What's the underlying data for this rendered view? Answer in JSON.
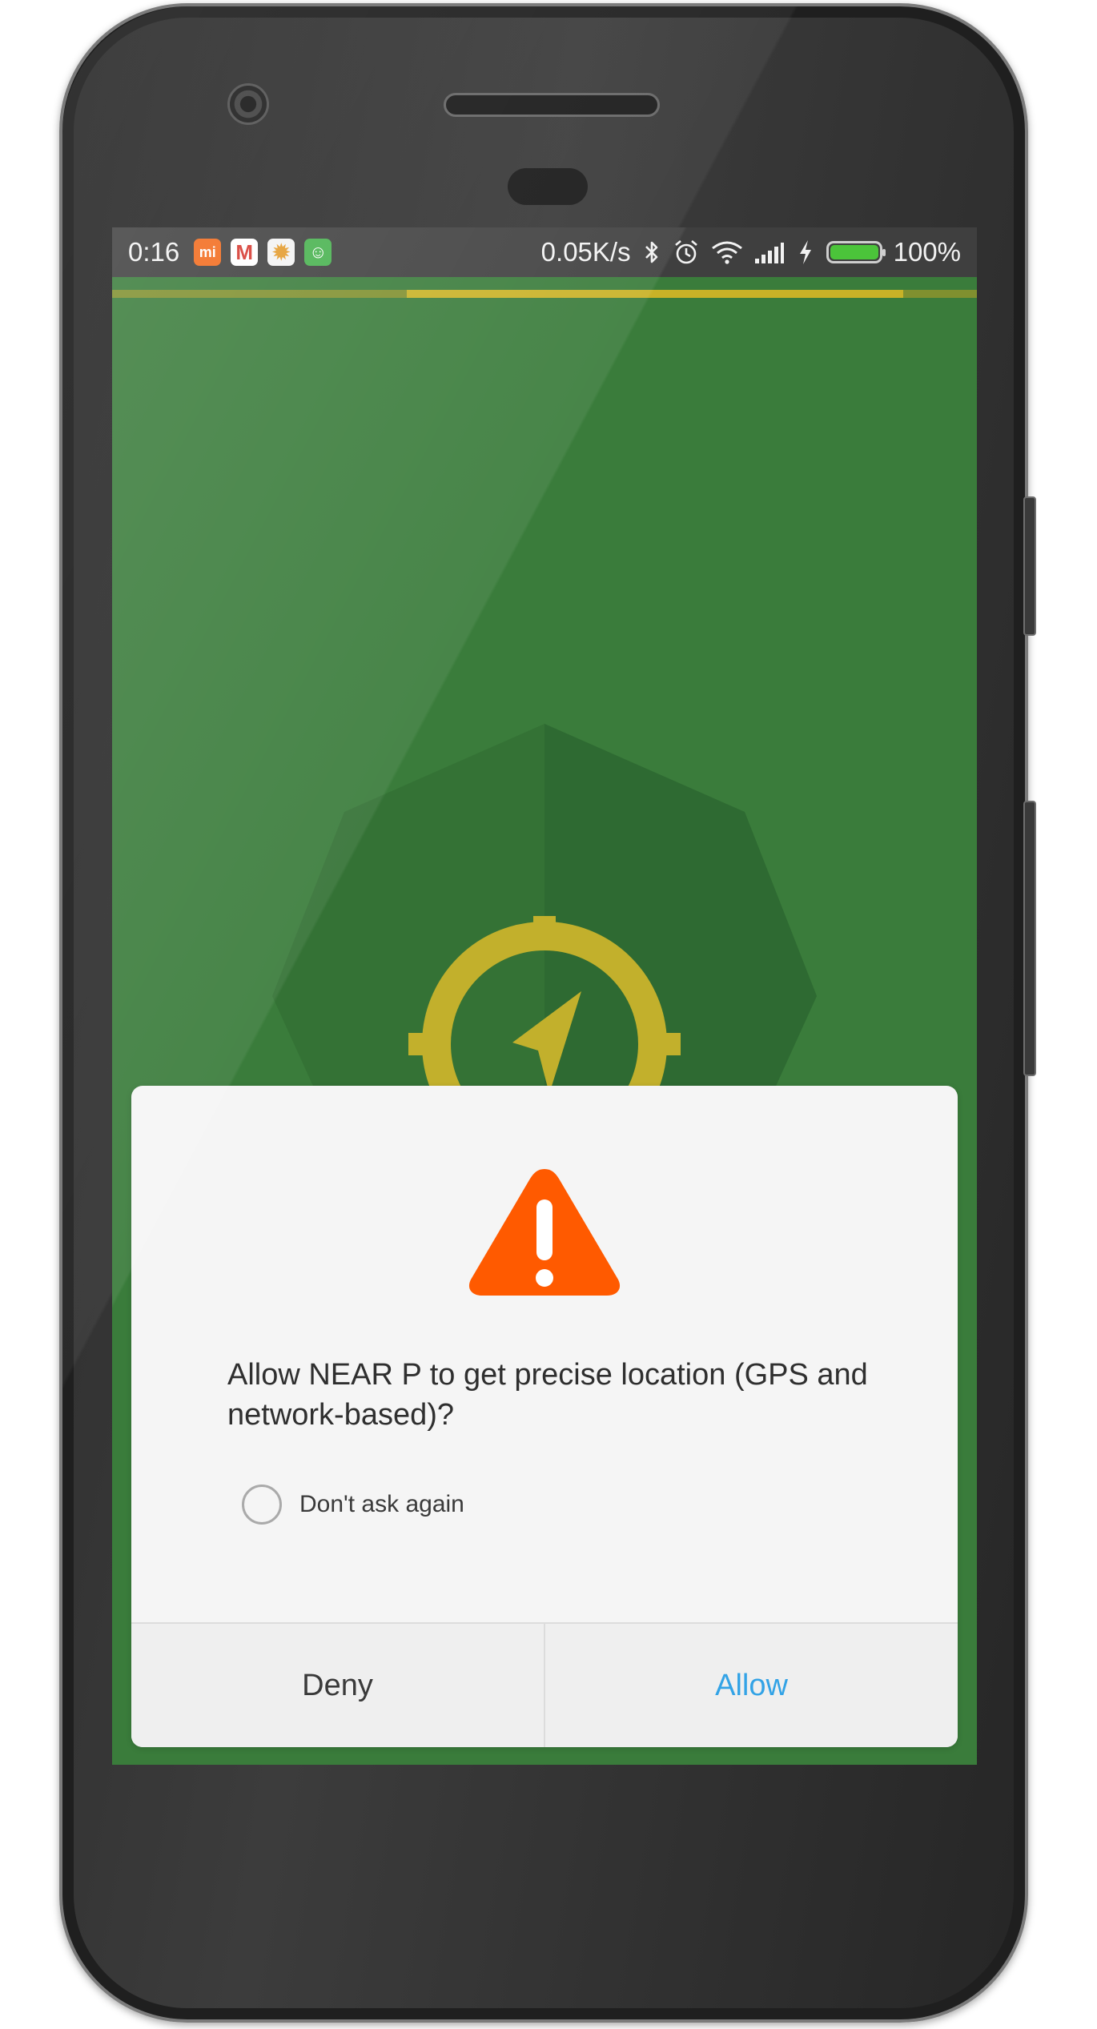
{
  "status_bar": {
    "time": "0:16",
    "notification_icons": [
      {
        "icon": "mi-icon",
        "glyph": "mi"
      },
      {
        "icon": "gmail-icon",
        "glyph": "M"
      },
      {
        "icon": "settings-icon",
        "glyph": "✹"
      },
      {
        "icon": "android-app-icon",
        "glyph": "☺"
      }
    ],
    "network_speed": "0.05K/s",
    "bluetooth_icon": "bluetooth-icon",
    "alarm_icon": "alarm-icon",
    "wifi_icon": "wifi-icon",
    "signal_icon": "signal-icon",
    "charging_icon": "charging-icon",
    "battery_level": 1.0,
    "battery_text": "100%"
  },
  "loading": {
    "track_color": "#80902f",
    "fill_color": "#c9b227"
  },
  "app_background_color": "#3a7c3b",
  "logo_icon": "navigation-target-icon",
  "dialog": {
    "icon": "warning-icon",
    "icon_color": "#ff5a00",
    "message": "Allow NEAR P to get precise location (GPS and network-based)?",
    "dont_ask_again_label": "Don't ask again",
    "dont_ask_again_checked": false,
    "deny_label": "Deny",
    "allow_label": "Allow",
    "allow_color": "#33a3e6"
  }
}
